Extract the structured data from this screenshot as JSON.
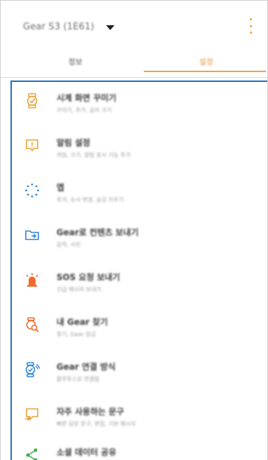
{
  "header": {
    "title": "Gear S3 (1E61)",
    "menu_icon": "more-vert-icon"
  },
  "tabs": [
    {
      "label": "정보"
    },
    {
      "label": "설정"
    }
  ],
  "items": [
    {
      "title": "시계 화면 꾸미기",
      "subtitle": "꾸미기, 추가, 글자 크기",
      "icon": "watch-face-icon",
      "color": "#e9a23b"
    },
    {
      "title": "알림 설정",
      "subtitle": "켜짐, 끄기, 알림 표시 기능 추가",
      "icon": "notification-icon",
      "color": "#e9a23b"
    },
    {
      "title": "앱",
      "subtitle": "추가, 순서 변경, 숨김 지우기",
      "icon": "apps-icon",
      "color": "#2f86d6"
    },
    {
      "title": "Gear로 컨텐츠 보내기",
      "subtitle": "음악, 사진",
      "icon": "send-content-icon",
      "color": "#2f86d6"
    },
    {
      "title": "SOS 요청 보내기",
      "subtitle": "긴급 메시지 보내기",
      "icon": "sos-icon",
      "color": "#ef6a2b"
    },
    {
      "title": "내 Gear 찾기",
      "subtitle": "찾기, Gear 잠금",
      "icon": "find-gear-icon",
      "color": "#ef6a2b"
    },
    {
      "title": "Gear 연결 방식",
      "subtitle": "블루투스로 연결됨",
      "icon": "connection-icon",
      "color": "#2f86d6"
    },
    {
      "title": "자주 사용하는 문구",
      "subtitle": "빠른 답장 문구, 편집, 기본 메시지",
      "icon": "quick-reply-icon",
      "color": "#e9a23b"
    },
    {
      "title": "소셜 데이터 공유",
      "subtitle": "",
      "icon": "share-icon",
      "color": "#3bb04a"
    }
  ]
}
